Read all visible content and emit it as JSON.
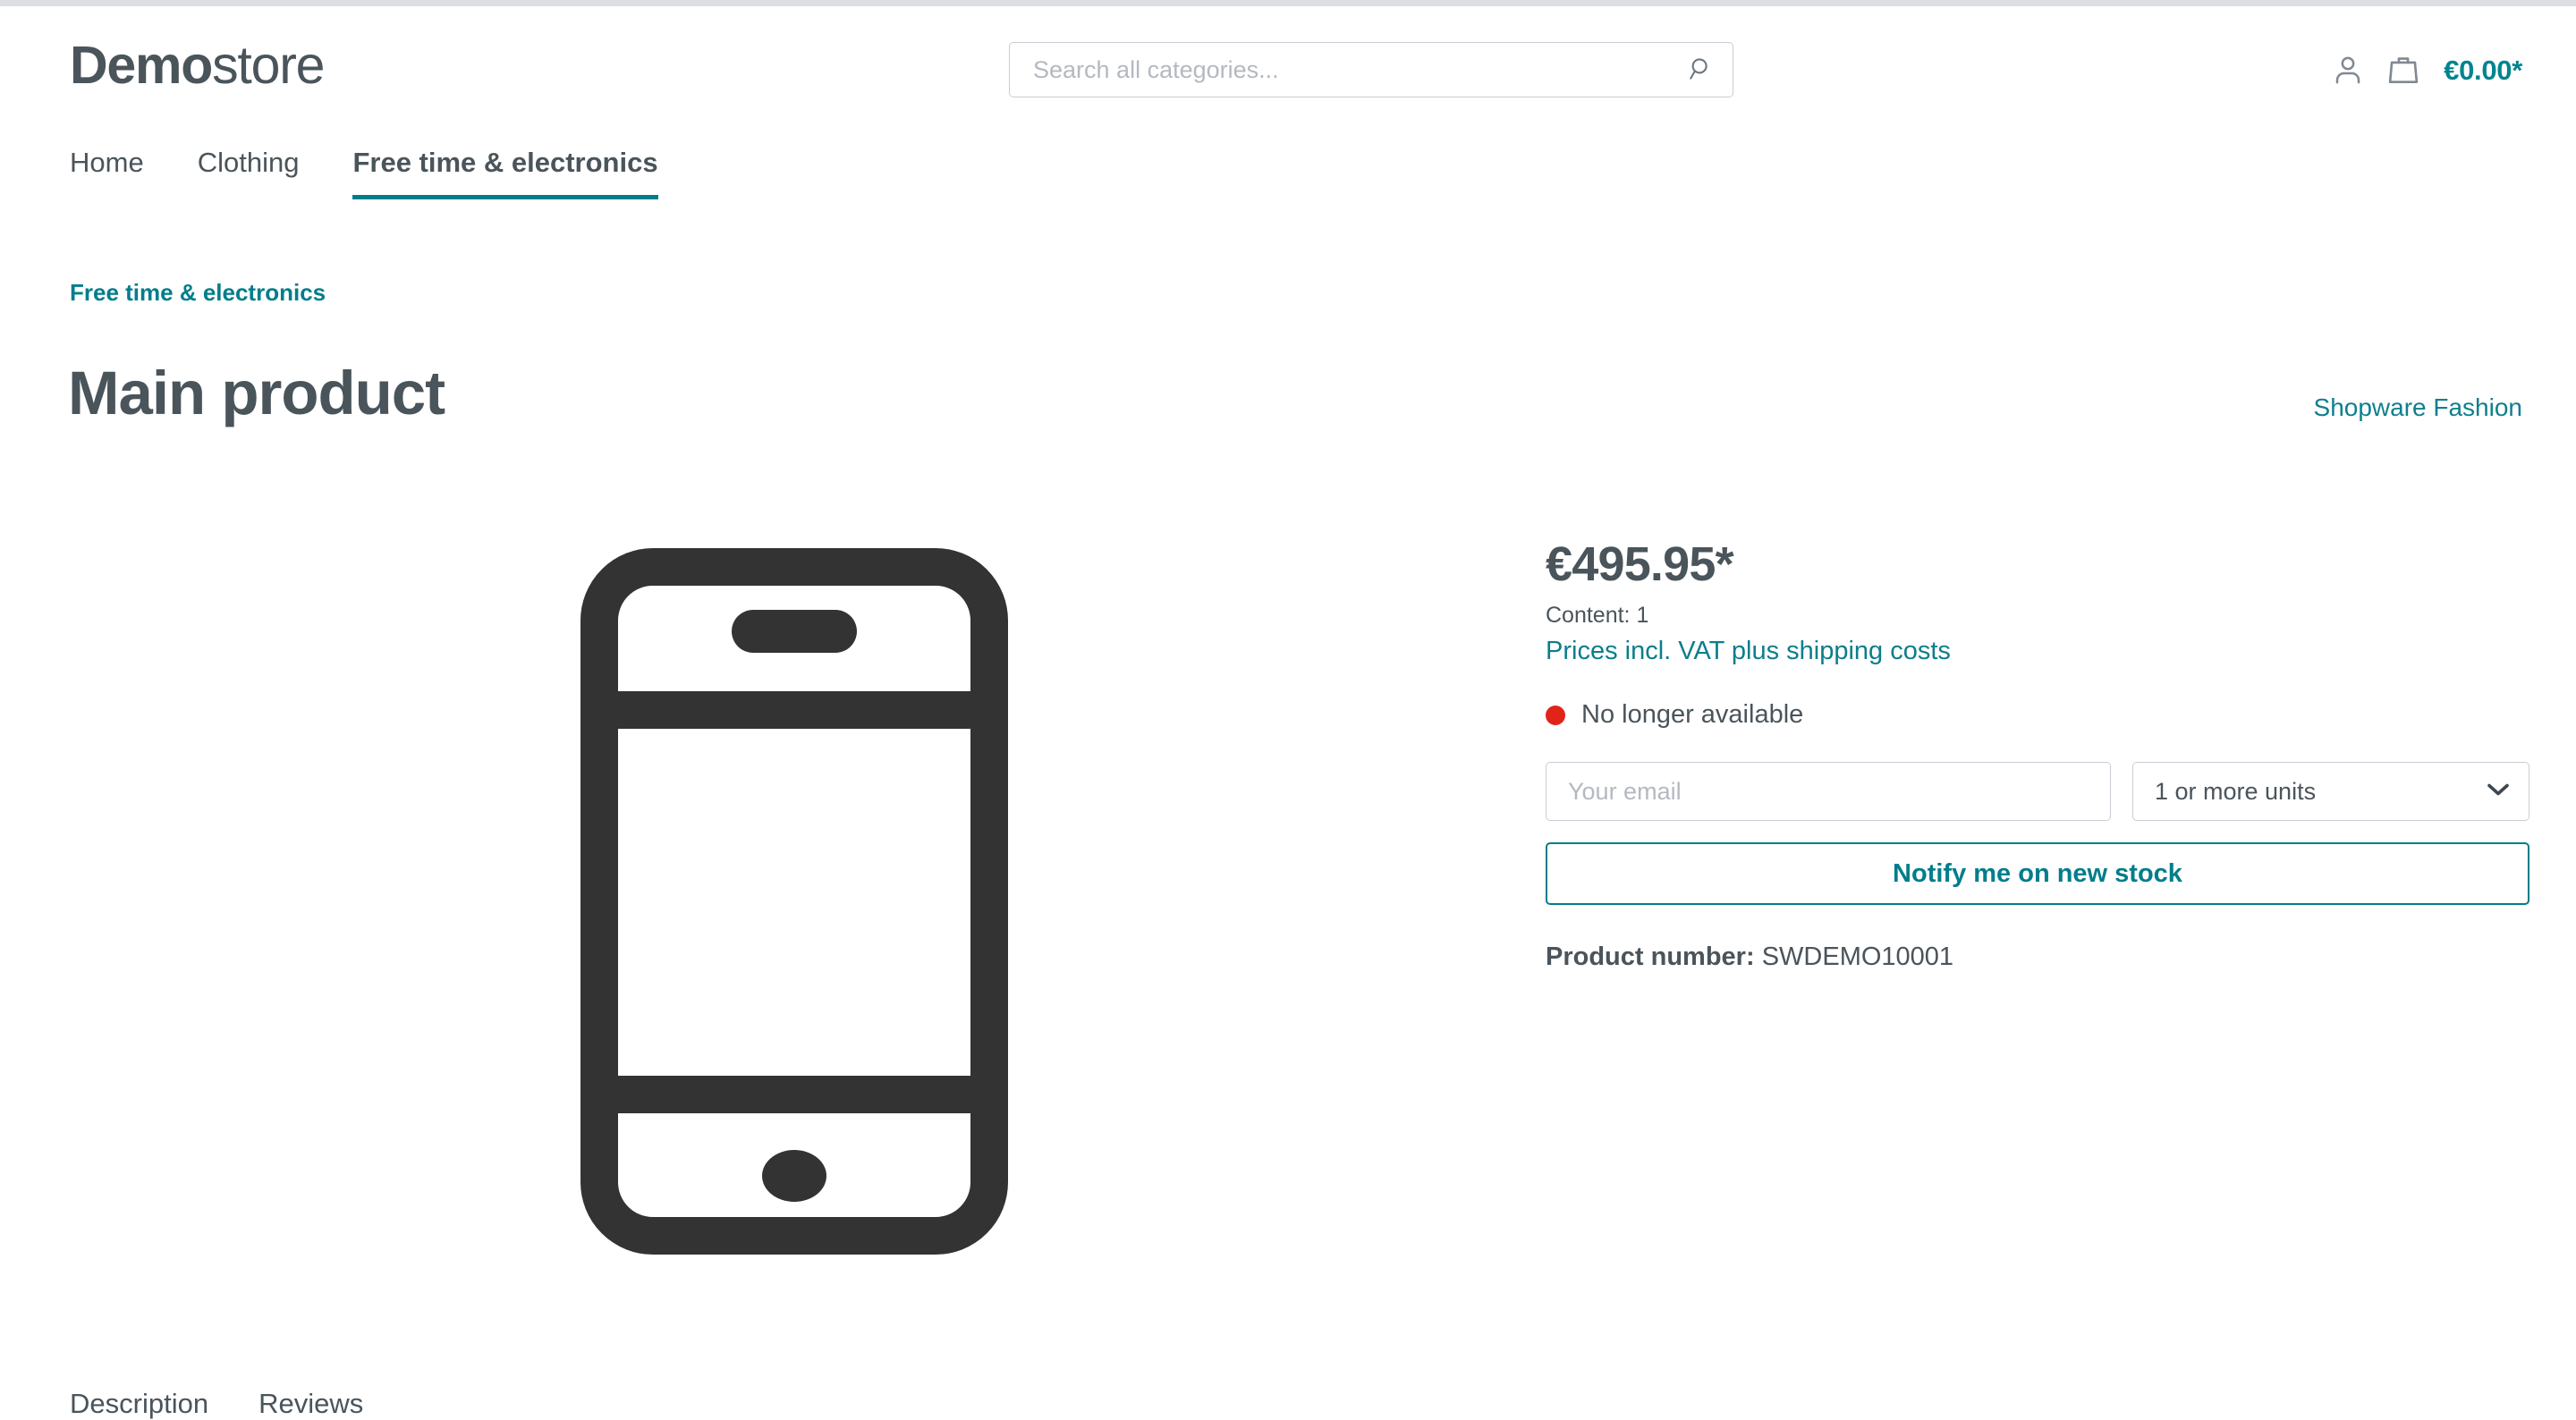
{
  "top_band": {},
  "header": {
    "logo": {
      "bold": "Demo",
      "light": "store"
    },
    "search": {
      "placeholder": "Search all categories...",
      "value": "",
      "icon": "search-icon"
    },
    "actions": {
      "account_icon": "user-icon",
      "cart_icon": "shopping-bag-icon",
      "cart_total": "€0.00*"
    }
  },
  "nav": {
    "items": [
      {
        "label": "Home",
        "active": false
      },
      {
        "label": "Clothing",
        "active": false
      },
      {
        "label": "Free time & electronics",
        "active": true
      }
    ]
  },
  "breadcrumb": {
    "label": "Free time & electronics"
  },
  "product": {
    "title": "Main product",
    "manufacturer": "Shopware Fashion",
    "image_icon": "smartphone-icon",
    "price": "€495.95*",
    "content": "Content: 1",
    "tax_note": "Prices incl. VAT plus shipping costs",
    "delivery_status": "No longer available",
    "status_color": "#e2231a",
    "notify": {
      "email_placeholder": "Your email",
      "email_value": "",
      "quantity_selected": "1 or more units",
      "quantity_options": [
        "1 or more units"
      ],
      "button_label": "Notify me on new stock",
      "chevron_icon": "chevron-down-icon"
    },
    "product_number_label": "Product number:",
    "product_number_value": "SWDEMO10001"
  },
  "detail_tabs": {
    "items": [
      {
        "label": "Description"
      },
      {
        "label": "Reviews"
      }
    ]
  },
  "colors": {
    "accent_teal": "#007d8b",
    "text_dark": "#4a545b",
    "border_gray": "#c8cdd4",
    "placeholder_gray": "#b4b9c0",
    "status_red": "#e2231a",
    "icon_dark": "#333333"
  }
}
